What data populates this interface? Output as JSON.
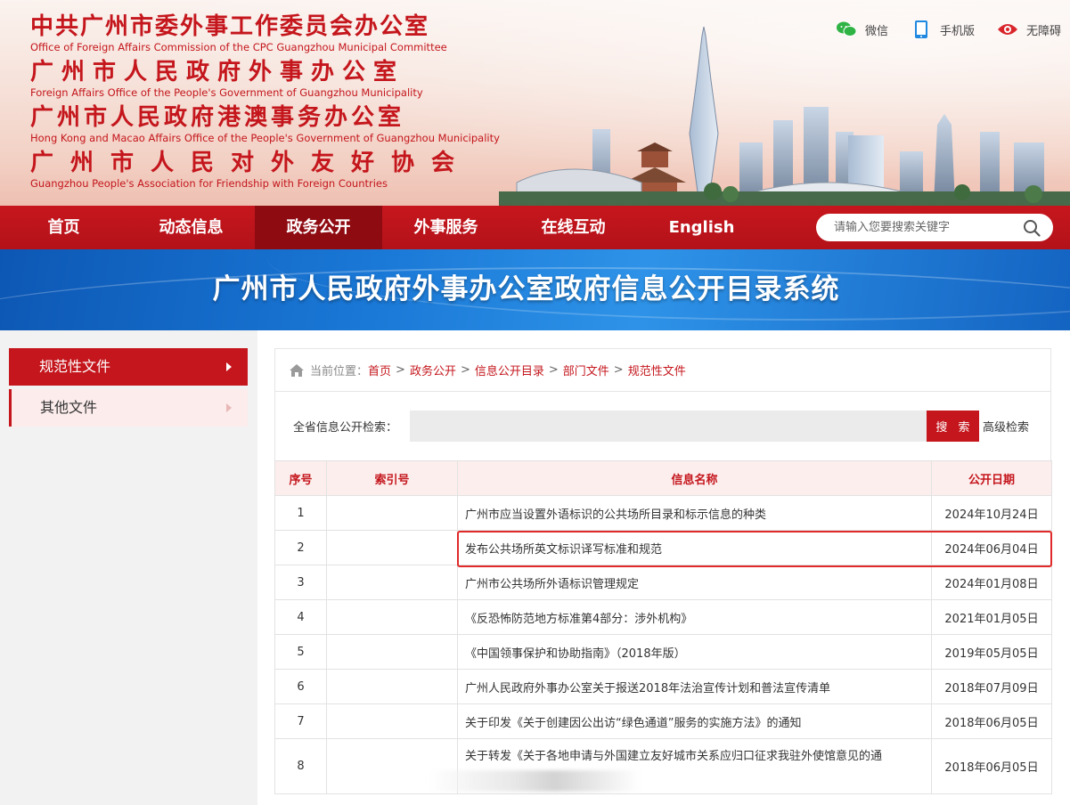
{
  "header": {
    "orgs": [
      {
        "zh": "中共广州市委外事工作委员会办公室",
        "en": "Office of Foreign Affairs Commission of the CPC Guangzhou Municipal Committee"
      },
      {
        "zh": "广州市人民政府外事办公室",
        "en": "Foreign Affairs Office of the People's Government of Guangzhou Municipality"
      },
      {
        "zh": "广州市人民政府港澳事务办公室",
        "en": "Hong Kong and Macao Affairs Office of the People's Government of Guangzhou Municipality"
      },
      {
        "zh": "广州市人民对外友好协会",
        "en": "Guangzhou People's Association for Friendship with Foreign Countries"
      }
    ],
    "top_links": {
      "wechat": "微信",
      "mobile": "手机版",
      "accessibility": "无障碍"
    }
  },
  "nav": {
    "items": [
      "首页",
      "动态信息",
      "政务公开",
      "外事服务",
      "在线互动",
      "English"
    ],
    "active_index": 2,
    "search_placeholder": "请输入您要搜索关键字"
  },
  "banner": {
    "title": "广州市人民政府外事办公室政府信息公开目录系统"
  },
  "sidebar": {
    "items": [
      {
        "label": "规范性文件",
        "active": true
      },
      {
        "label": "其他文件",
        "active": false
      }
    ]
  },
  "breadcrumb": {
    "prefix": "当前位置：",
    "items": [
      "首页",
      "政务公开",
      "信息公开目录",
      "部门文件",
      "规范性文件"
    ],
    "separator": ">"
  },
  "search": {
    "label": "全省信息公开检索：",
    "button": "搜 索",
    "advanced": "高级检索"
  },
  "table": {
    "headers": [
      "序号",
      "索引号",
      "信息名称",
      "公开日期"
    ],
    "rows": [
      {
        "no": "1",
        "index": "",
        "title": "广州市应当设置外语标识的公共场所目录和标示信息的种类",
        "date": "2024年10月24日"
      },
      {
        "no": "2",
        "index": "",
        "title": "发布公共场所英文标识译写标准和规范",
        "date": "2024年06月04日"
      },
      {
        "no": "3",
        "index": "",
        "title": "广州市公共场所外语标识管理规定",
        "date": "2024年01月08日"
      },
      {
        "no": "4",
        "index": "",
        "title": "《反恐怖防范地方标准第4部分：涉外机构》",
        "date": "2021年01月05日"
      },
      {
        "no": "5",
        "index": "",
        "title": "《中国领事保护和协助指南》（2018年版）",
        "date": "2019年05月05日"
      },
      {
        "no": "6",
        "index": "",
        "title": "广州人民政府外事办公室关于报送2018年法治宣传计划和普法宣传清单",
        "date": "2018年07月09日"
      },
      {
        "no": "7",
        "index": "",
        "title": "关于印发《关于创建因公出访“绿色通道”服务的实施方法》的通知",
        "date": "2018年06月05日"
      },
      {
        "no": "8",
        "index": "",
        "title": "关于转发《关于各地申请与外国建立友好城市关系应归口征求我驻外使馆意见的通",
        "date": "2018年06月05日"
      }
    ],
    "highlighted_row": 1
  },
  "colors": {
    "brand_red": "#c4161c",
    "banner_blue": "#1a78d6",
    "highlight": "#e02a2a"
  }
}
